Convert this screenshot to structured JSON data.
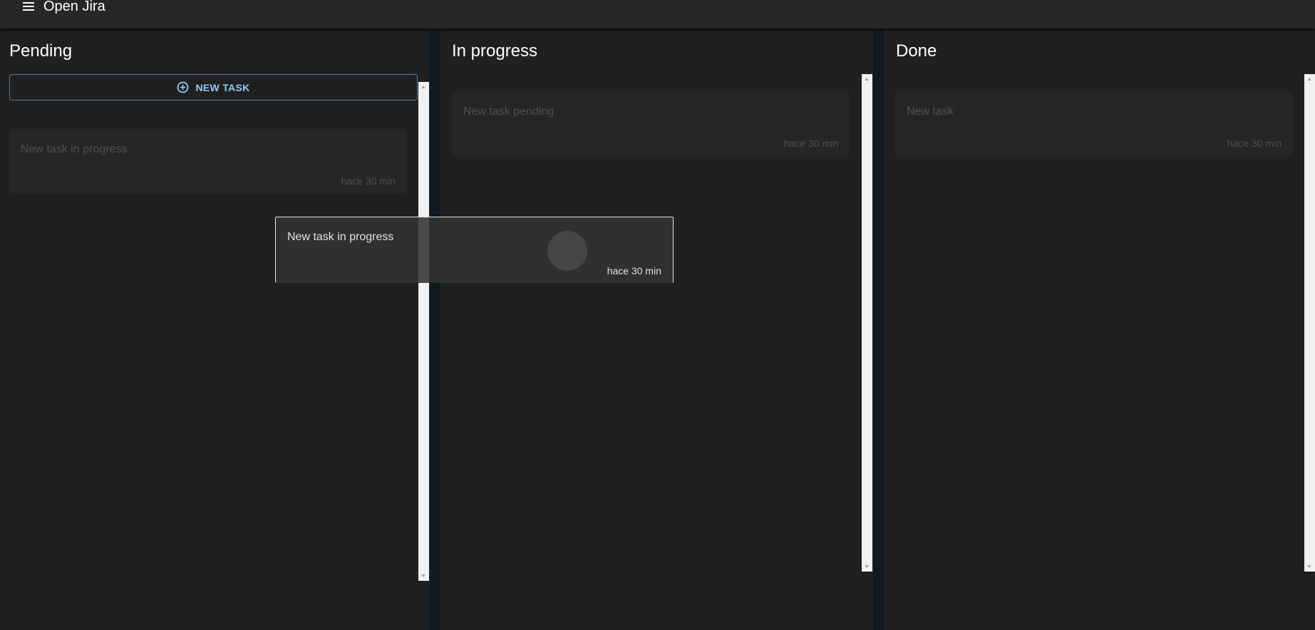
{
  "appbar": {
    "title": "Open Jira",
    "menu_icon": "menu-icon"
  },
  "columns": {
    "pending": {
      "title": "Pending",
      "new_task_label": "NEW TASK",
      "cards": [
        {
          "text": "New task in progress",
          "time": "hace 30 min"
        }
      ]
    },
    "in_progress": {
      "title": "In progress",
      "cards": [
        {
          "text": "New task pending",
          "time": "hace 30 min"
        }
      ]
    },
    "done": {
      "title": "Done",
      "cards": [
        {
          "text": "New task",
          "time": "hace 30 min"
        }
      ]
    }
  },
  "dragging_card": {
    "text": "New task in progress",
    "time": "hace 30 min"
  },
  "colors": {
    "background": "#0f1a20",
    "appbar": "#272727",
    "column": "#202020",
    "accent": "#90caf9"
  }
}
